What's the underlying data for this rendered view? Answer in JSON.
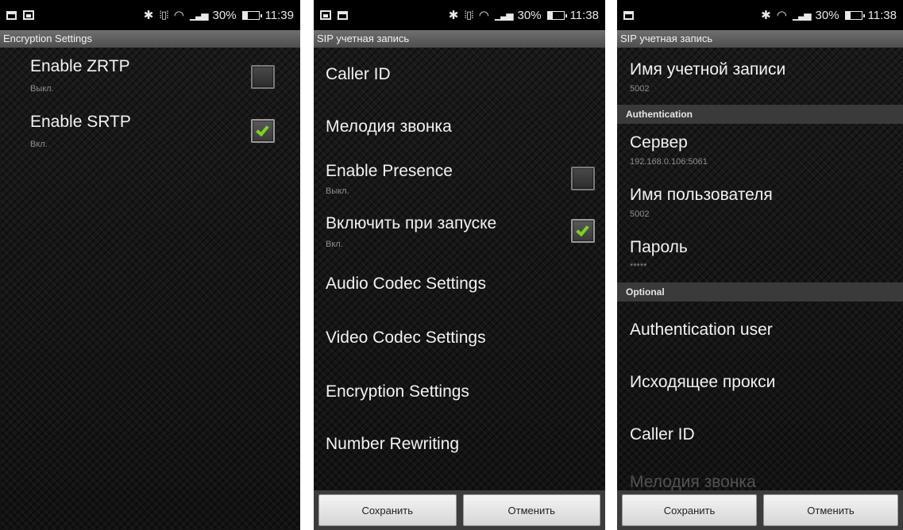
{
  "screen1": {
    "status": {
      "battery": "30%",
      "time": "11:39"
    },
    "title": "Encryption Settings",
    "items": [
      {
        "title": "Enable ZRTP",
        "summary": "Выкл.",
        "checked": false
      },
      {
        "title": "Enable SRTP",
        "summary": "Вкл.",
        "checked": true
      }
    ]
  },
  "screen2": {
    "status": {
      "battery": "30%",
      "time": "11:38"
    },
    "title": "SIP учетная запись",
    "items": [
      {
        "title": "Caller ID"
      },
      {
        "title": "Мелодия звонка"
      },
      {
        "title": "Enable Presence",
        "summary": "Выкл.",
        "checked": false
      },
      {
        "title": "Включить при запуске",
        "summary": "Вкл.",
        "checked": true
      },
      {
        "title": "Audio Codec Settings"
      },
      {
        "title": "Video Codec Settings"
      },
      {
        "title": "Encryption Settings"
      },
      {
        "title": "Number Rewriting"
      }
    ],
    "buttons": {
      "save": "Сохранить",
      "cancel": "Отменить"
    }
  },
  "screen3": {
    "status": {
      "battery": "30%",
      "time": "11:38"
    },
    "title": "SIP учетная запись",
    "account": {
      "title": "Имя учетной записи",
      "summary": "5002"
    },
    "sections": {
      "authentication": "Authentication",
      "optional": "Optional"
    },
    "auth_items": [
      {
        "title": "Сервер",
        "summary": "192.168.0.106:5061"
      },
      {
        "title": "Имя пользователя",
        "summary": "5002"
      },
      {
        "title": "Пароль",
        "summary": "*****"
      }
    ],
    "optional_items": [
      {
        "title": "Authentication user"
      },
      {
        "title": "Исходящее прокси"
      },
      {
        "title": "Caller ID"
      },
      {
        "title": "Мелодия звонка"
      }
    ],
    "buttons": {
      "save": "Сохранить",
      "cancel": "Отменить"
    }
  },
  "icons": [
    "notification-icon",
    "image-icon",
    "bluetooth-icon",
    "vibrate-icon",
    "wifi-icon",
    "signal-icon",
    "battery-icon",
    "checkmark-icon"
  ]
}
